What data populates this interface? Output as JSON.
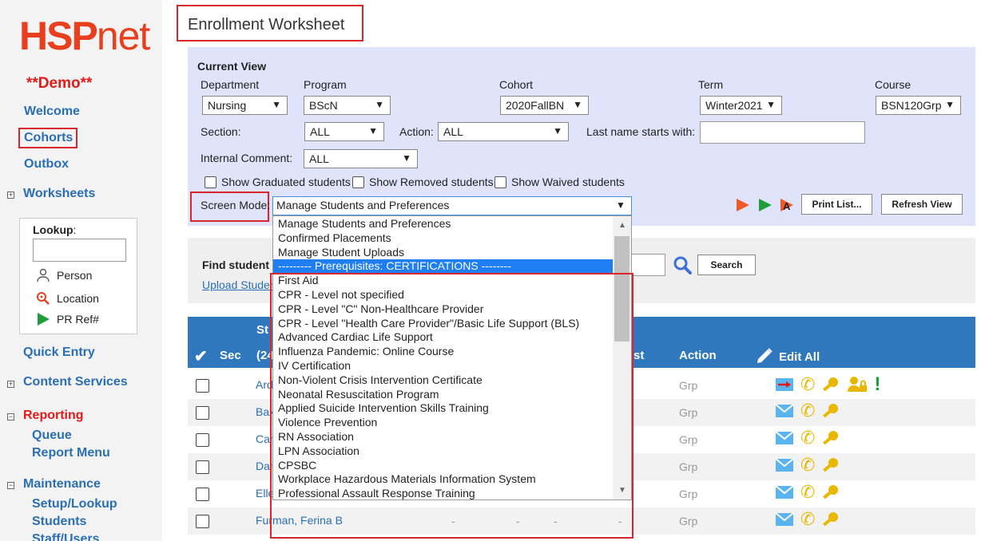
{
  "sidebar": {
    "logo_hsp": "HSP",
    "logo_net": "net",
    "demo": "**Demo**",
    "welcome": "Welcome",
    "cohorts": "Cohorts",
    "outbox": "Outbox",
    "worksheets": "Worksheets",
    "lookup_title": "Lookup",
    "lookup_colon": ":",
    "lookup_person": "Person",
    "lookup_location": "Location",
    "lookup_prref": "PR Ref#",
    "quick_entry": "Quick Entry",
    "content_services": "Content Services",
    "reporting": "Reporting",
    "queue": "Queue",
    "report_menu": "Report Menu",
    "maintenance": "Maintenance",
    "setup_lookup": "Setup/Lookup",
    "students": "Students",
    "staff_users": "Staff/Users"
  },
  "page_title": "Enrollment Worksheet",
  "current_view": {
    "label": "Current View",
    "department_label": "Department",
    "department_value": "Nursing",
    "program_label": "Program",
    "program_value": "BScN",
    "cohort_label": "Cohort",
    "cohort_value": "2020FallBN",
    "term_label": "Term",
    "term_value": "Winter2021",
    "course_label": "Course",
    "course_value": "BSN120Grp",
    "section_label": "Section:",
    "section_value": "ALL",
    "action_label": "Action:",
    "action_value": "ALL",
    "lastname_label": "Last name starts with:",
    "internal_comment_label": "Internal Comment:",
    "internal_comment_value": "ALL",
    "show_graduated": "Show Graduated students",
    "show_removed": "Show Removed students",
    "show_waived": "Show Waived students",
    "screen_mode_label": "Screen Mode:",
    "screen_mode_value": "Manage Students and Preferences",
    "print_list": "Print List...",
    "refresh_view": "Refresh View"
  },
  "search": {
    "find_label": "Find student t",
    "upload_link": "Upload Studen",
    "search_button": "Search"
  },
  "table": {
    "headers": {
      "check": "✔",
      "sec": "Sec",
      "st_top": "St",
      "st_bottom": "(24",
      "st_col": "st",
      "action": "Action",
      "edit_all": "Edit All"
    },
    "rows": [
      {
        "name": "Ard",
        "grp": "Grp"
      },
      {
        "name": "Bax",
        "grp": "Grp"
      },
      {
        "name": "Car",
        "grp": "Grp"
      },
      {
        "name": "Dar",
        "grp": "Grp"
      },
      {
        "name": "Elle",
        "grp": "Grp"
      },
      {
        "name": "Furman, Ferina B",
        "grp": "Grp",
        "d1": "-",
        "d2": "-",
        "d3": "-",
        "d4": "-"
      }
    ]
  },
  "dropdown": {
    "options": [
      "Manage Students and Preferences",
      "Confirmed Placements",
      "Manage Student Uploads",
      "--------- Prerequisites: CERTIFICATIONS --------",
      "First Aid",
      "CPR - Level not specified",
      "CPR - Level \"C\" Non-Healthcare Provider",
      "CPR - Level \"Health Care Provider\"/Basic Life Support (BLS)",
      "Advanced Cardiac Life Support",
      "Influenza Pandemic: Online Course",
      "IV Certification",
      "Non-Violent Crisis Intervention Certificate",
      "Neonatal Resuscitation Program",
      "Applied Suicide Intervention Skills Training",
      "Violence Prevention",
      "RN Association",
      "LPN Association",
      "CPSBC",
      "Workplace Hazardous Materials Information System",
      "Professional Assault Response Training"
    ],
    "selected_index": 3
  },
  "colors": {
    "brand": "#e8401f",
    "link": "#2a6fb5",
    "highlight": "#d9262c",
    "table_header": "#2f78bd",
    "panel": "#dfe4fa"
  }
}
